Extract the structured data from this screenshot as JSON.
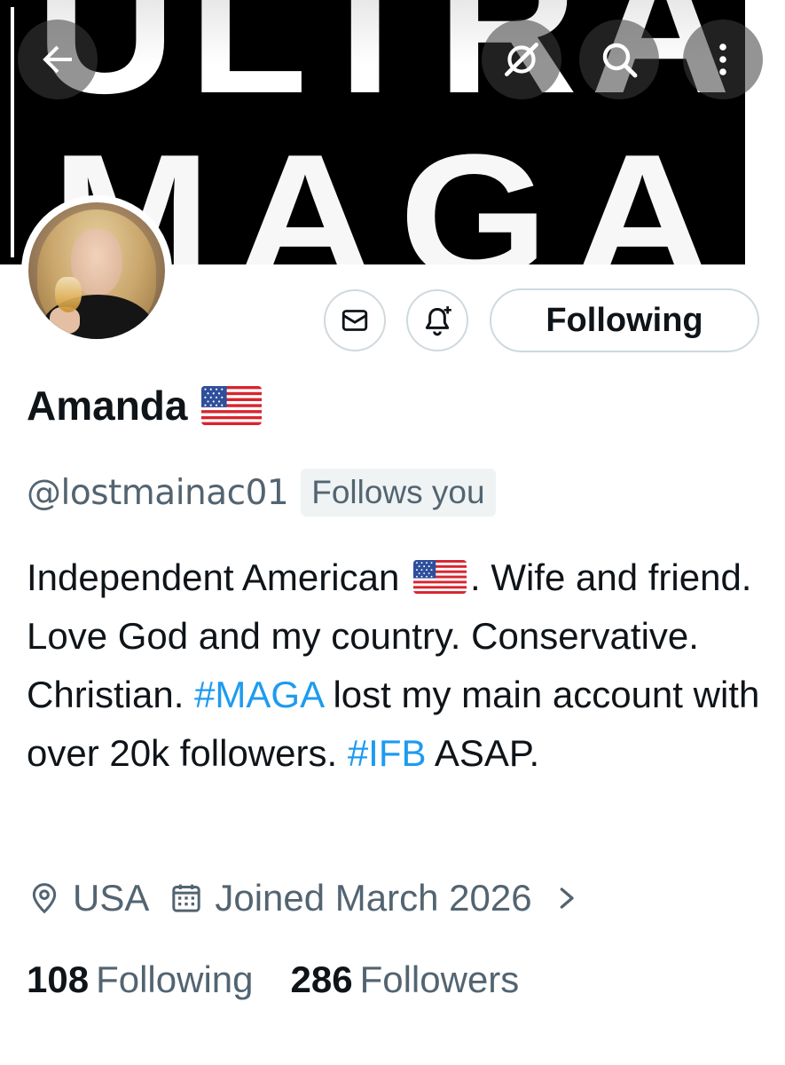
{
  "banner": {
    "line1": "ULTRA",
    "line2": "MAGA"
  },
  "header_icons": {
    "back": "arrow-left-icon",
    "broken_link": "link-off-icon",
    "search": "search-icon",
    "more": "more-vertical-icon"
  },
  "actions": {
    "message_icon": "mail-icon",
    "notify_icon": "bell-plus-icon",
    "follow_label": "Following"
  },
  "profile": {
    "display_name": "Amanda",
    "handle": "@lostmainac01",
    "follows_you_badge": "Follows you",
    "bio": {
      "part1": "Independent American",
      "part2": ". Wife and friend. Love God and my country. Conservative. Christian. ",
      "hashtag1": "#MAGA",
      "part3": " lost my main account with over 20k followers. ",
      "hashtag2": "#IFB",
      "part4": " ASAP."
    },
    "location": "USA",
    "joined": "Joined March 2026",
    "following_count": "108",
    "following_label": "Following",
    "followers_count": "286",
    "followers_label": "Followers"
  },
  "colors": {
    "link": "#1d9bf0",
    "secondary_text": "#536471",
    "primary_text": "#0f1419",
    "border": "#cfd9de",
    "badge_bg": "#eff3f4"
  }
}
